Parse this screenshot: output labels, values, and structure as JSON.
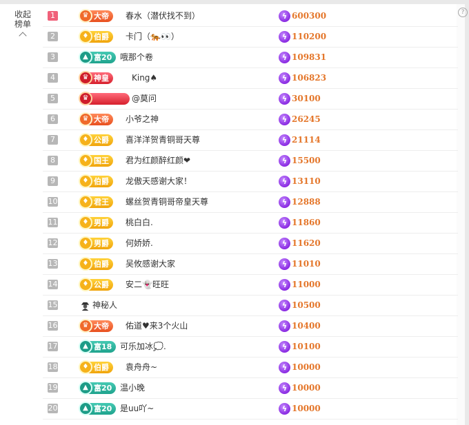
{
  "header": {
    "collapse_label_line1": "收起",
    "collapse_label_line2": "榜单",
    "help_label": "?"
  },
  "ranking": [
    {
      "rank": "1",
      "badge": "大帝",
      "badge_icon": "crown",
      "badge_style": "red",
      "name": "春水（潜伏找不到）",
      "score": "600300"
    },
    {
      "rank": "2",
      "badge": "伯爵",
      "badge_icon": "flame",
      "badge_style": "gold",
      "name": "卡门（🐅👀）",
      "score": "110200"
    },
    {
      "rank": "3",
      "badge": "富20",
      "badge_icon": "mountain",
      "badge_style": "teal",
      "name": "哦那个卷",
      "score": "109831"
    },
    {
      "rank": "4",
      "badge": "神皇",
      "badge_icon": "crown",
      "badge_style": "crimson",
      "name": "King♠",
      "score": "106823"
    },
    {
      "rank": "5",
      "badge": "",
      "badge_icon": "crown",
      "badge_style": "crimson",
      "name": "@莫问",
      "score": "30100"
    },
    {
      "rank": "6",
      "badge": "大帝",
      "badge_icon": "crown",
      "badge_style": "red",
      "name": "小爷之神",
      "score": "26245"
    },
    {
      "rank": "7",
      "badge": "公爵",
      "badge_icon": "flame",
      "badge_style": "gold",
      "name": "喜洋洋贺青铜哥天尊",
      "score": "21114"
    },
    {
      "rank": "8",
      "badge": "国王",
      "badge_icon": "flame",
      "badge_style": "gold",
      "name": "君为红颜醉红颜❤",
      "score": "15500"
    },
    {
      "rank": "9",
      "badge": "伯爵",
      "badge_icon": "flame",
      "badge_style": "gold",
      "name": "龙傲天感谢大家！",
      "score": "13110"
    },
    {
      "rank": "10",
      "badge": "君王",
      "badge_icon": "flame",
      "badge_style": "gold",
      "name": "螺丝贺青铜哥帝皇天尊",
      "score": "12888"
    },
    {
      "rank": "11",
      "badge": "男爵",
      "badge_icon": "flame",
      "badge_style": "gold",
      "name": "桃白白.",
      "score": "11860"
    },
    {
      "rank": "12",
      "badge": "男爵",
      "badge_icon": "flame",
      "badge_style": "gold",
      "name": "何娇娇.",
      "score": "11620"
    },
    {
      "rank": "13",
      "badge": "伯爵",
      "badge_icon": "flame",
      "badge_style": "gold",
      "name": "吴攸感谢大家",
      "score": "11010"
    },
    {
      "rank": "14",
      "badge": "公爵",
      "badge_icon": "flame",
      "badge_style": "gold",
      "name": "安二👻旺旺",
      "score": "11000"
    },
    {
      "rank": "15",
      "badge": "",
      "badge_icon": "mystery",
      "badge_style": "none",
      "name": "神秘人",
      "score": "10500"
    },
    {
      "rank": "16",
      "badge": "大帝",
      "badge_icon": "crown",
      "badge_style": "red",
      "name": "佑道♥来3个火山",
      "score": "10400"
    },
    {
      "rank": "17",
      "badge": "富18",
      "badge_icon": "mountain",
      "badge_style": "teal",
      "name": "可乐加冰💭.",
      "score": "10100"
    },
    {
      "rank": "18",
      "badge": "伯爵",
      "badge_icon": "flame",
      "badge_style": "gold",
      "name": "袁舟舟~",
      "score": "10000"
    },
    {
      "rank": "19",
      "badge": "富20",
      "badge_icon": "mountain",
      "badge_style": "teal",
      "name": "温小晚",
      "score": "10000"
    },
    {
      "rank": "20",
      "badge": "富20",
      "badge_icon": "mountain",
      "badge_style": "teal",
      "name": "是uu吖~",
      "score": "10000"
    }
  ]
}
